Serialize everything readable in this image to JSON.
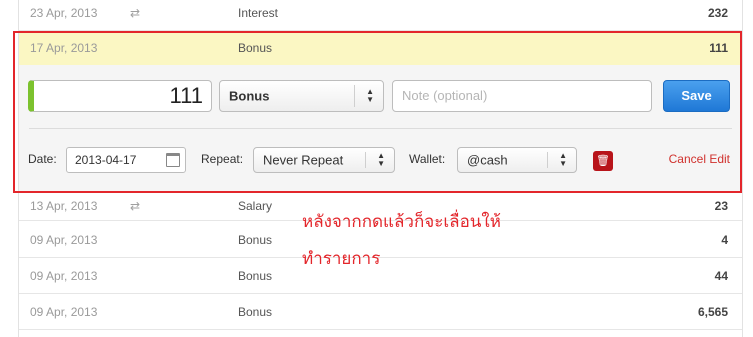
{
  "transactions_above": [
    {
      "date": "23 Apr, 2013",
      "repeat_icon": "repeat-icon",
      "category": "Interest",
      "amount": "232"
    }
  ],
  "editing_row": {
    "date": "17 Apr, 2013",
    "category": "Bonus",
    "amount": "111"
  },
  "editor": {
    "amount": "111",
    "category": "Bonus",
    "note_placeholder": "Note (optional)",
    "save_label": "Save",
    "date_label": "Date:",
    "date_value": "2013-04-17",
    "repeat_label": "Repeat:",
    "repeat_value": "Never Repeat",
    "wallet_label": "Wallet:",
    "wallet_value": "@cash",
    "cancel_label": "Cancel Edit"
  },
  "transactions_below": [
    {
      "date": "13 Apr, 2013",
      "repeat_icon": "repeat-icon",
      "category": "Salary",
      "amount": "23"
    },
    {
      "date": "09 Apr, 2013",
      "category": "Bonus",
      "amount": "4"
    },
    {
      "date": "09 Apr, 2013",
      "category": "Bonus",
      "amount": "44"
    },
    {
      "date": "09 Apr, 2013",
      "category": "Bonus",
      "amount": "6,565"
    }
  ],
  "annotation": {
    "line1": "หลังจากกดแล้วก็จะเลื่อนให้",
    "line2": "ทำรายการ"
  },
  "colors": {
    "highlight": "#fbf7c3",
    "accent_green": "#7cc22e",
    "save_blue": "#1f78d6",
    "annotation_red": "#e3262b"
  }
}
